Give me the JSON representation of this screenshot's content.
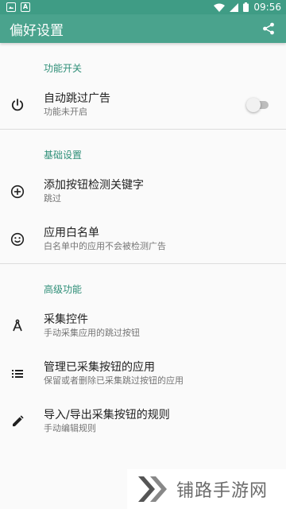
{
  "status_bar": {
    "time": "09:56",
    "notification_icons": [
      "image-notification-icon",
      "a-notification-icon"
    ],
    "status_icons": [
      "wifi-icon",
      "cellular-signal-icon",
      "battery-icon"
    ]
  },
  "app_bar": {
    "title": "偏好设置",
    "share_icon": "share-icon"
  },
  "sections": [
    {
      "header": "功能开关",
      "items": [
        {
          "title": "自动跳过广告",
          "summary": "功能未开启",
          "icon": "power-icon",
          "toggle": false
        }
      ]
    },
    {
      "header": "基础设置",
      "items": [
        {
          "title": "添加按钮检测关键字",
          "summary": "跳过",
          "icon": "add-circle-icon"
        },
        {
          "title": "应用白名单",
          "summary": "白名单中的应用不会被检测广告",
          "icon": "smiley-icon"
        }
      ]
    },
    {
      "header": "高级功能",
      "items": [
        {
          "title": "采集控件",
          "summary": "手动采集应用的跳过按钮",
          "icon": "compass-tool-icon"
        },
        {
          "title": "管理已采集按钮的应用",
          "summary": "保留或者删除已采集跳过按钮的应用",
          "icon": "list-icon"
        },
        {
          "title": "导入/导出采集按钮的规则",
          "summary": "手动编辑规则",
          "icon": "pencil-icon"
        }
      ]
    }
  ],
  "watermark": {
    "text": "铺路手游网",
    "icon": "watermark-logo-icon"
  },
  "colors": {
    "status_bar": "#3f9c85",
    "app_bar": "#4aa38d",
    "accent": "#2f8f78",
    "background": "#fafafa"
  }
}
